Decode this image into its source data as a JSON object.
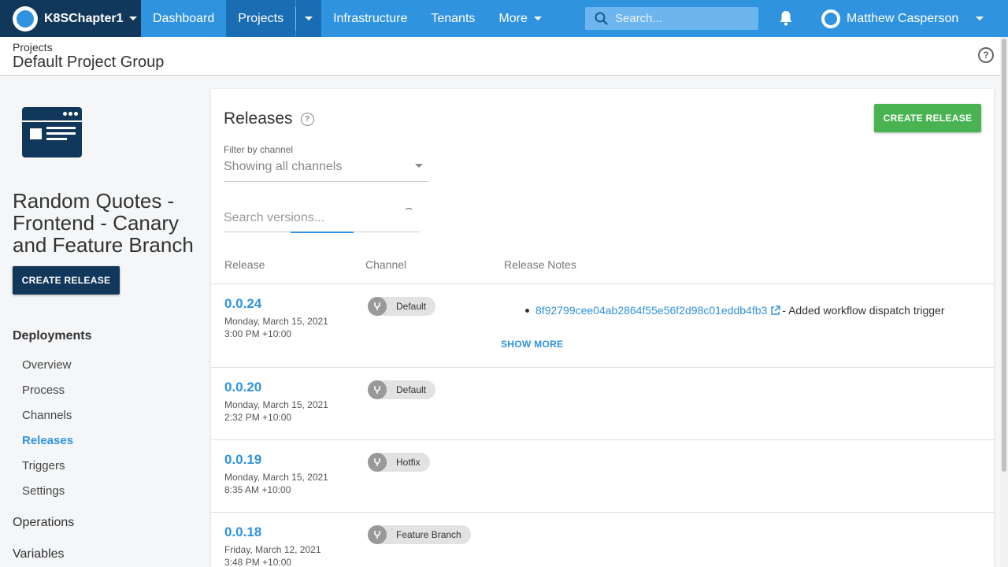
{
  "topnav": {
    "space_name": "K8SChapter1",
    "links": {
      "dashboard": "Dashboard",
      "projects": "Projects",
      "infrastructure": "Infrastructure",
      "tenants": "Tenants",
      "more": "More"
    },
    "search_placeholder": "Search...",
    "user_name": "Matthew Casperson"
  },
  "breadcrumb": {
    "parent": "Projects",
    "title": "Default Project Group"
  },
  "sidebar": {
    "project_name": "Random Quotes - Frontend - Canary and Feature Branch",
    "create_release_label": "CREATE RELEASE",
    "deployments_heading": "Deployments",
    "items": [
      "Overview",
      "Process",
      "Channels",
      "Releases",
      "Triggers",
      "Settings"
    ],
    "active_item": "Releases",
    "operations_heading": "Operations",
    "variables_heading": "Variables"
  },
  "main": {
    "title": "Releases",
    "create_release_label": "CREATE RELEASE",
    "filter_label": "Filter by channel",
    "filter_value": "Showing all channels",
    "search_placeholder": "Search versions...",
    "columns": [
      "Release",
      "Channel",
      "Release Notes"
    ],
    "releases": [
      {
        "version": "0.0.24",
        "date": "Monday, March 15, 2021",
        "time": "3:00 PM +10:00",
        "channel": "Default"
      },
      {
        "version": "0.0.20",
        "date": "Monday, March 15, 2021",
        "time": "2:32 PM +10:00",
        "channel": "Default"
      },
      {
        "version": "0.0.19",
        "date": "Monday, March 15, 2021",
        "time": "8:35 AM +10:00",
        "channel": "Hotfix"
      },
      {
        "version": "0.0.18",
        "date": "Friday, March 12, 2021",
        "time": "3:48 PM +10:00",
        "channel": "Feature Branch"
      }
    ],
    "release_note": {
      "commit": "8f92799cee04ab2864f55e56f2d98c01eddb4fb3",
      "text": " - Added workflow dispatch trigger"
    },
    "show_more_label": "SHOW MORE"
  },
  "colors": {
    "nav_blue": "#2f93e0",
    "nav_dark": "#11375a",
    "green": "#48b350"
  }
}
